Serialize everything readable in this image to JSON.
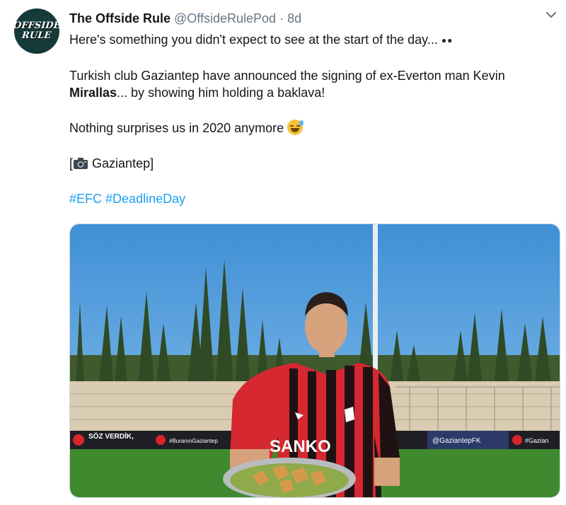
{
  "tweet": {
    "author_name": "The Offside Rule",
    "author_handle": "@OffsideRulePod",
    "separator": "·",
    "time_ago": "8d",
    "avatar_lines": [
      "OFFSIDE",
      "RULE"
    ],
    "line1": "Here's something you didn't expect to see at the start of the day...",
    "line2_prefix": "Turkish club Gaziantep have announced the signing of ex-Everton man Kevin",
    "line2_bold": "Mirallas",
    "line2_suffix": "... by showing him holding a baklava!",
    "line3": "Nothing surprises us in 2020 anymore",
    "credit_open": "[",
    "credit_text": "Gaziantep]",
    "hashtags": [
      "#EFC",
      "#DeadlineDay"
    ]
  },
  "photo": {
    "shirt_sponsor": "SANKO",
    "board_texts": [
      "SÖZ VERDİK,",
      "#BuranınGaziantep",
      "@GaziantepFK",
      "#Gazian"
    ]
  },
  "icons": {
    "menu": "chevron-down-icon",
    "camera": "camera-icon",
    "emoji": "sweat-smile-icon",
    "eyes": "eyes-icon"
  },
  "colors": {
    "hashtag": "#1da1f2",
    "handle": "#657786",
    "text": "#14171a",
    "avatar_bg": "#163a3a"
  }
}
